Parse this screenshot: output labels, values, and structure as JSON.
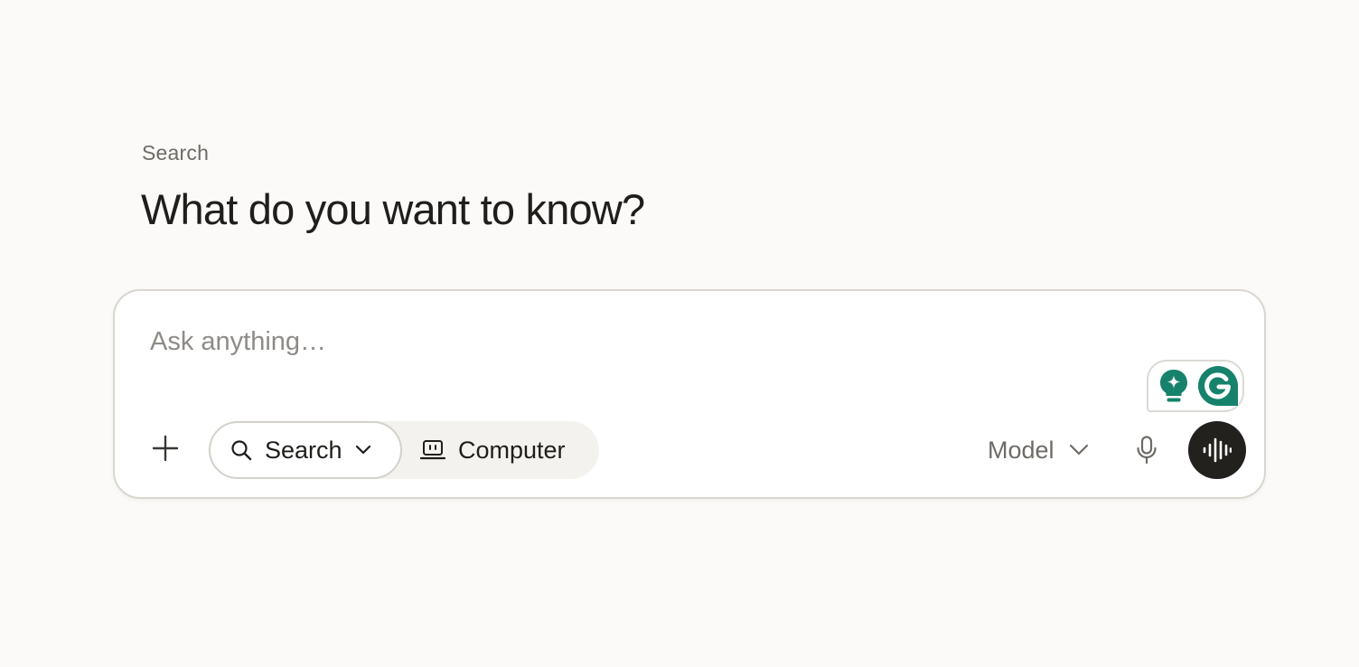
{
  "header": {
    "eyebrow": "Search",
    "title": "What do you want to know?"
  },
  "composer": {
    "placeholder": "Ask anything…",
    "value": "",
    "attach_icon": "plus-icon",
    "modes": [
      {
        "label": "Search",
        "icon": "search-icon",
        "selected": true
      },
      {
        "label": "Computer",
        "icon": "computer-icon",
        "selected": false
      }
    ],
    "model_label": "Model",
    "mic_icon": "microphone-icon",
    "voice_icon": "voice-waveform-icon"
  },
  "grammarly": {
    "icons": [
      "lightbulb-sparkle-icon",
      "grammarly-g-icon"
    ]
  },
  "colors": {
    "background": "#fbfaf8",
    "text": "#1f1e1b",
    "muted": "#6e6b66",
    "border": "#d9d6d0",
    "voice_button": "#23211e",
    "grammarly_green": "#16826c"
  }
}
